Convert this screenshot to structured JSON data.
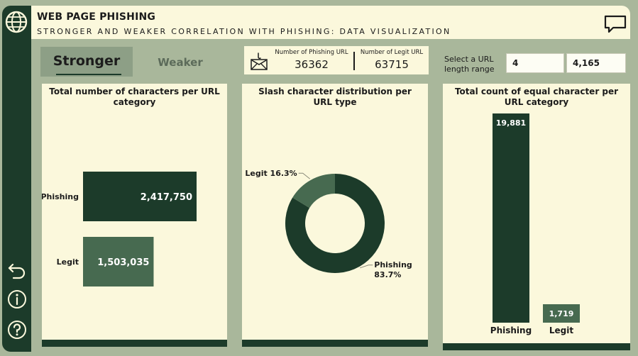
{
  "header": {
    "title": "WEB PAGE PHISHING",
    "subtitle": "STRONGER AND WEAKER CORRELATION WITH PHISHING: DATA VISUALIZATION"
  },
  "sidebar": {
    "icons": [
      "globe-icon",
      "back-arrow-icon",
      "info-icon",
      "help-icon"
    ]
  },
  "header_icons": [
    "comment-icon"
  ],
  "tabs": [
    {
      "label": "Stronger",
      "selected": true
    },
    {
      "label": "Weaker",
      "selected": false
    }
  ],
  "kpi": {
    "icon": "mail-hook-icon",
    "phishing_label": "Number of Phishing URL",
    "phishing_value": "36362",
    "legit_label": "Number of Legit URL",
    "legit_value": "63715"
  },
  "range_filter": {
    "label": "Select a URL length range",
    "min": "4",
    "max": "4,165"
  },
  "colors": {
    "dark_green": "#1c3b2a",
    "mid_green": "#476a50",
    "card_bg": "#fbf8dc",
    "page_bg": "#a9b79b"
  },
  "chart_data": [
    {
      "type": "bar",
      "orientation": "horizontal",
      "title": "Total number of characters per URL category",
      "categories": [
        "Phishing",
        "Legit"
      ],
      "values": [
        2417750,
        1503035
      ],
      "value_labels": [
        "2,417,750",
        "1,503,035"
      ],
      "colors": [
        "#1c3b2a",
        "#476a50"
      ]
    },
    {
      "type": "pie",
      "variant": "donut",
      "title": "Slash character distribution per URL type",
      "categories": [
        "Phishing",
        "Legit"
      ],
      "values": [
        83.7,
        16.3
      ],
      "value_labels": [
        "83.7%",
        "16.3%"
      ],
      "colors": [
        "#1c3b2a",
        "#476a50"
      ]
    },
    {
      "type": "bar",
      "orientation": "vertical",
      "title": "Total count of equal character per URL category",
      "categories": [
        "Phishing",
        "Legit"
      ],
      "values": [
        19881,
        1719
      ],
      "value_labels": [
        "19,881",
        "1,719"
      ],
      "colors": [
        "#1c3b2a",
        "#476a50"
      ]
    }
  ]
}
